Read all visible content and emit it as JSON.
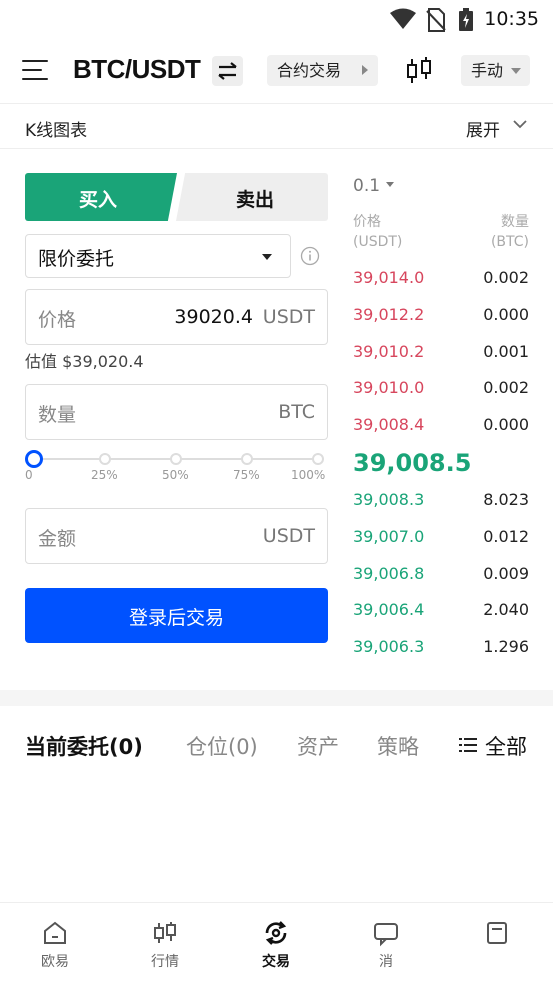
{
  "status_bar": {
    "time": "10:35"
  },
  "header": {
    "pair": "BTC/USDT",
    "contract_label": "合约交易",
    "mode_label": "手动"
  },
  "kline_bar": {
    "label": "K线图表",
    "expand_label": "展开"
  },
  "trade_form": {
    "buy_tab": "买入",
    "sell_tab": "卖出",
    "order_type": "限价委托",
    "price_placeholder": "价格",
    "price_value": "39020.4",
    "price_unit": "USDT",
    "estimate": "估值 $39,020.4",
    "amount_placeholder": "数量",
    "amount_unit": "BTC",
    "slider_position": 0,
    "slider_labels": [
      "0",
      "25%",
      "50%",
      "75%",
      "100%"
    ],
    "total_placeholder": "金额",
    "total_unit": "USDT",
    "login_button": "登录后交易"
  },
  "order_book": {
    "depth": "0.1",
    "price_header": "价格",
    "price_header_unit": "(USDT)",
    "qty_header": "数量",
    "qty_header_unit": "(BTC)",
    "asks": [
      {
        "price": "39,014.0",
        "qty": "0.002"
      },
      {
        "price": "39,012.2",
        "qty": "0.000"
      },
      {
        "price": "39,010.2",
        "qty": "0.001"
      },
      {
        "price": "39,010.0",
        "qty": "0.002"
      },
      {
        "price": "39,008.4",
        "qty": "0.000"
      }
    ],
    "last_price": "39,008.5",
    "bids": [
      {
        "price": "39,008.3",
        "qty": "8.023"
      },
      {
        "price": "39,007.0",
        "qty": "0.012"
      },
      {
        "price": "39,006.8",
        "qty": "0.009"
      },
      {
        "price": "39,006.4",
        "qty": "2.040"
      },
      {
        "price": "39,006.3",
        "qty": "1.296"
      }
    ]
  },
  "orders": {
    "tabs": [
      "当前委托(0)",
      "仓位(0)",
      "资产",
      "策略"
    ],
    "all_label": "全部"
  },
  "bottom_nav": [
    {
      "label": "欧易",
      "icon": "home-icon"
    },
    {
      "label": "行情",
      "icon": "market-icon"
    },
    {
      "label": "交易",
      "icon": "trade-icon"
    },
    {
      "label": "消",
      "icon": "message-icon"
    },
    {
      "label": "",
      "icon": "assets-icon"
    }
  ],
  "colors": {
    "buy_green": "#1aa478",
    "sell_red": "#d7465d",
    "primary_blue": "#0052ff"
  }
}
